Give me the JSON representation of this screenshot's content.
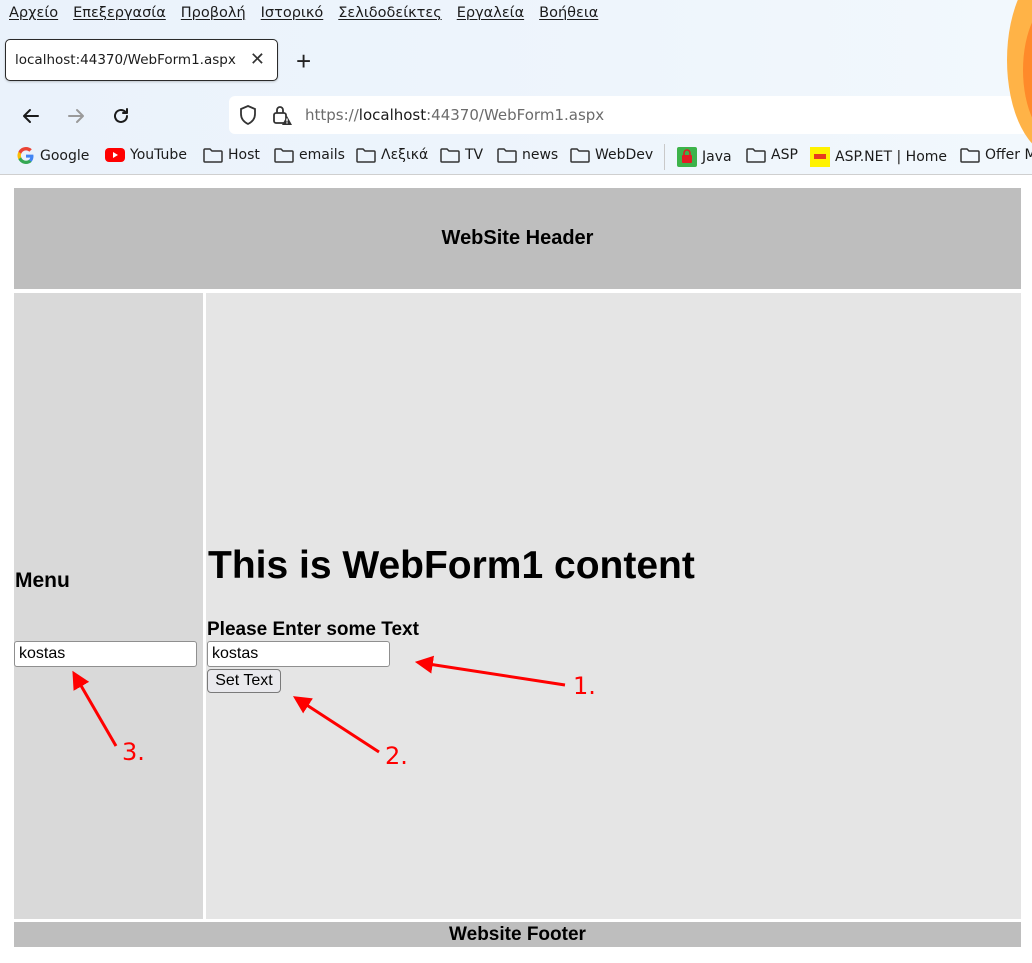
{
  "browser": {
    "menu": [
      "Αρχείο",
      "Επεξεργασία",
      "Προβολή",
      "Ιστορικό",
      "Σελιδοδείκτες",
      "Εργαλεία",
      "Βοήθεια"
    ],
    "tab_title": "localhost:44370/WebForm1.aspx",
    "url_prefix": "https://",
    "url_host": "localhost",
    "url_rest": ":44370/WebForm1.aspx",
    "bookmarks": [
      "Google",
      "YouTube",
      "Host",
      "emails",
      "Λεξικά",
      "TV",
      "news",
      "WebDev",
      "Java",
      "ASP",
      "ASP.NET | Home",
      "Offer M"
    ]
  },
  "page": {
    "header": "WebSite Header",
    "menu_title": "Menu",
    "menu_input_value": "kostas",
    "content_title": "This is WebForm1 content",
    "prompt": "Please Enter some Text",
    "content_input_value": "kostas",
    "button_label": "Set Text",
    "footer": "Website Footer"
  },
  "annotations": {
    "labels": [
      "1.",
      "2.",
      "3."
    ],
    "color": "#ff0000"
  },
  "colors": {
    "header_bg": "#bebebe",
    "menu_bg": "#d9d9d9",
    "content_bg": "#e5e5e5"
  }
}
